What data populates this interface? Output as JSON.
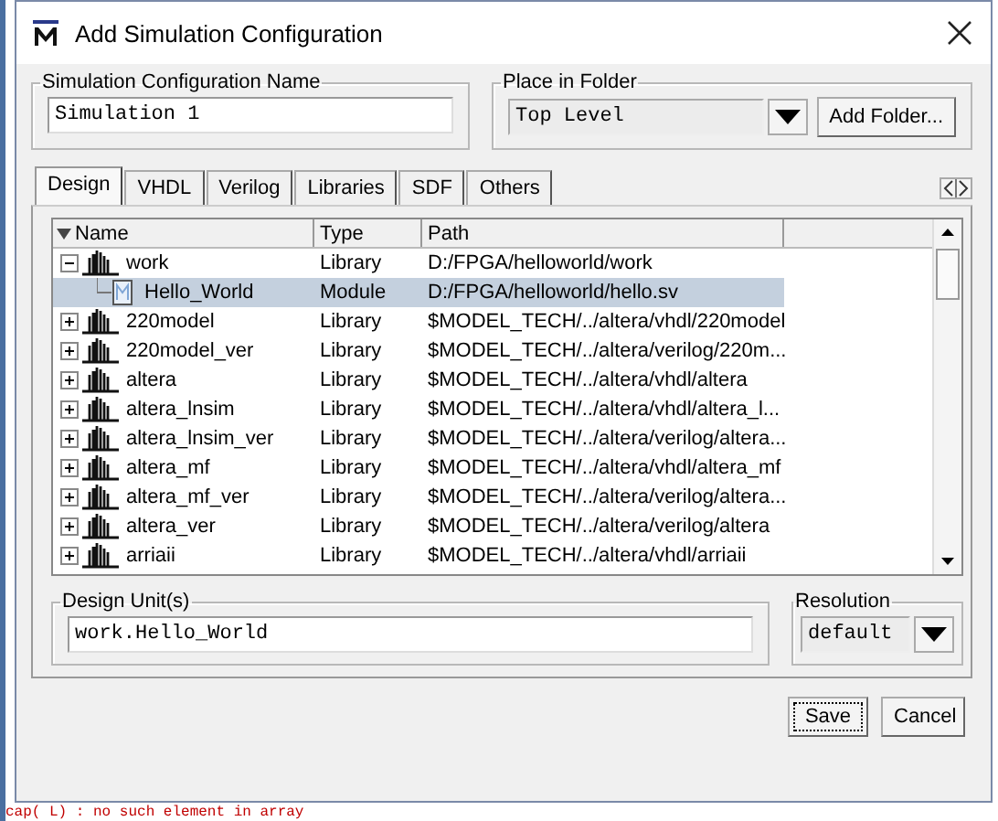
{
  "window": {
    "title": "Add Simulation Configuration"
  },
  "config_name": {
    "label": "Simulation Configuration Name",
    "value": "Simulation 1"
  },
  "folder": {
    "label": "Place in Folder",
    "value": "Top Level",
    "button": "Add Folder..."
  },
  "tabs": [
    {
      "label": "Design",
      "selected": true
    },
    {
      "label": "VHDL",
      "selected": false
    },
    {
      "label": "Verilog",
      "selected": false
    },
    {
      "label": "Libraries",
      "selected": false
    },
    {
      "label": "SDF",
      "selected": false
    },
    {
      "label": "Others",
      "selected": false
    }
  ],
  "table": {
    "columns": [
      "Name",
      "Type",
      "Path"
    ],
    "rows": [
      {
        "name": "work",
        "type": "Library",
        "path": "D:/FPGA/helloworld/work",
        "kind": "library",
        "expanded": true,
        "selected": false,
        "children": [
          {
            "name": "Hello_World",
            "type": "Module",
            "path": "D:/FPGA/helloworld/hello.sv",
            "kind": "module",
            "selected": true
          }
        ]
      },
      {
        "name": "220model",
        "type": "Library",
        "path": "$MODEL_TECH/../altera/vhdl/220model",
        "kind": "library",
        "expanded": false,
        "selected": false
      },
      {
        "name": "220model_ver",
        "type": "Library",
        "path": "$MODEL_TECH/../altera/verilog/220m...",
        "kind": "library",
        "expanded": false,
        "selected": false
      },
      {
        "name": "altera",
        "type": "Library",
        "path": "$MODEL_TECH/../altera/vhdl/altera",
        "kind": "library",
        "expanded": false,
        "selected": false
      },
      {
        "name": "altera_lnsim",
        "type": "Library",
        "path": "$MODEL_TECH/../altera/vhdl/altera_l...",
        "kind": "library",
        "expanded": false,
        "selected": false
      },
      {
        "name": "altera_lnsim_ver",
        "type": "Library",
        "path": "$MODEL_TECH/../altera/verilog/altera...",
        "kind": "library",
        "expanded": false,
        "selected": false
      },
      {
        "name": "altera_mf",
        "type": "Library",
        "path": "$MODEL_TECH/../altera/vhdl/altera_mf",
        "kind": "library",
        "expanded": false,
        "selected": false
      },
      {
        "name": "altera_mf_ver",
        "type": "Library",
        "path": "$MODEL_TECH/../altera/verilog/altera...",
        "kind": "library",
        "expanded": false,
        "selected": false
      },
      {
        "name": "altera_ver",
        "type": "Library",
        "path": "$MODEL_TECH/../altera/verilog/altera",
        "kind": "library",
        "expanded": false,
        "selected": false
      },
      {
        "name": "arriaii",
        "type": "Library",
        "path": "$MODEL_TECH/../altera/vhdl/arriaii",
        "kind": "library",
        "expanded": false,
        "selected": false
      }
    ]
  },
  "design_units": {
    "label": "Design Unit(s)",
    "value": "work.Hello_World"
  },
  "resolution": {
    "label": "Resolution",
    "value": "default"
  },
  "buttons": [
    "Save",
    "Cancel"
  ],
  "background_console": {
    "text": "cap( L) : no such element in array"
  }
}
